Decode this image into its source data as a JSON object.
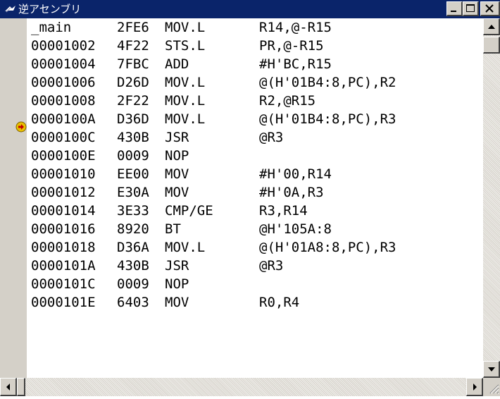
{
  "window": {
    "title": "逆アセンブリ"
  },
  "listing": {
    "rows": [
      {
        "addr": "_main",
        "code": "2FE6",
        "mnemonic": "MOV.L",
        "operands": "R14,@-R15",
        "pc": false
      },
      {
        "addr": "00001002",
        "code": "4F22",
        "mnemonic": "STS.L",
        "operands": "PR,@-R15",
        "pc": false
      },
      {
        "addr": "00001004",
        "code": "7FBC",
        "mnemonic": "ADD",
        "operands": "#H'BC,R15",
        "pc": false
      },
      {
        "addr": "00001006",
        "code": "D26D",
        "mnemonic": "MOV.L",
        "operands": "@(H'01B4:8,PC),R2",
        "pc": true
      },
      {
        "addr": "00001008",
        "code": "2F22",
        "mnemonic": "MOV.L",
        "operands": "R2,@R15",
        "pc": false
      },
      {
        "addr": "0000100A",
        "code": "D36D",
        "mnemonic": "MOV.L",
        "operands": "@(H'01B4:8,PC),R3",
        "pc": false
      },
      {
        "addr": "0000100C",
        "code": "430B",
        "mnemonic": "JSR",
        "operands": "@R3",
        "pc": false
      },
      {
        "addr": "0000100E",
        "code": "0009",
        "mnemonic": "NOP",
        "operands": "",
        "pc": false
      },
      {
        "addr": "00001010",
        "code": "EE00",
        "mnemonic": "MOV",
        "operands": "#H'00,R14",
        "pc": false
      },
      {
        "addr": "00001012",
        "code": "E30A",
        "mnemonic": "MOV",
        "operands": "#H'0A,R3",
        "pc": false
      },
      {
        "addr": "00001014",
        "code": "3E33",
        "mnemonic": "CMP/GE",
        "operands": "R3,R14",
        "pc": false
      },
      {
        "addr": "00001016",
        "code": "8920",
        "mnemonic": "BT",
        "operands": "@H'105A:8",
        "pc": false
      },
      {
        "addr": "00001018",
        "code": "D36A",
        "mnemonic": "MOV.L",
        "operands": "@(H'01A8:8,PC),R3",
        "pc": false
      },
      {
        "addr": "0000101A",
        "code": "430B",
        "mnemonic": "JSR",
        "operands": "@R3",
        "pc": false
      },
      {
        "addr": "0000101C",
        "code": "0009",
        "mnemonic": "NOP",
        "operands": "",
        "pc": false
      },
      {
        "addr": "0000101E",
        "code": "6403",
        "mnemonic": "MOV",
        "operands": "R0,R4",
        "pc": false
      }
    ]
  },
  "icons": {
    "window": "disassembly-window-icon",
    "minimize": "minimize-icon",
    "maximize": "maximize-icon",
    "close": "close-icon",
    "pc_marker": "current-pc-arrow-icon",
    "scroll_up": "arrow-up-icon",
    "scroll_down": "arrow-down-icon",
    "scroll_left": "arrow-left-icon",
    "scroll_right": "arrow-right-icon",
    "resize_grip": "resize-grip-icon"
  },
  "colors": {
    "title_bar": "#0a246a",
    "pc_marker": "#e8c000",
    "gutter": "#d4d0c8"
  },
  "scrollbars": {
    "vertical_position_fraction": 0.0,
    "horizontal_position_fraction": 0.0
  }
}
